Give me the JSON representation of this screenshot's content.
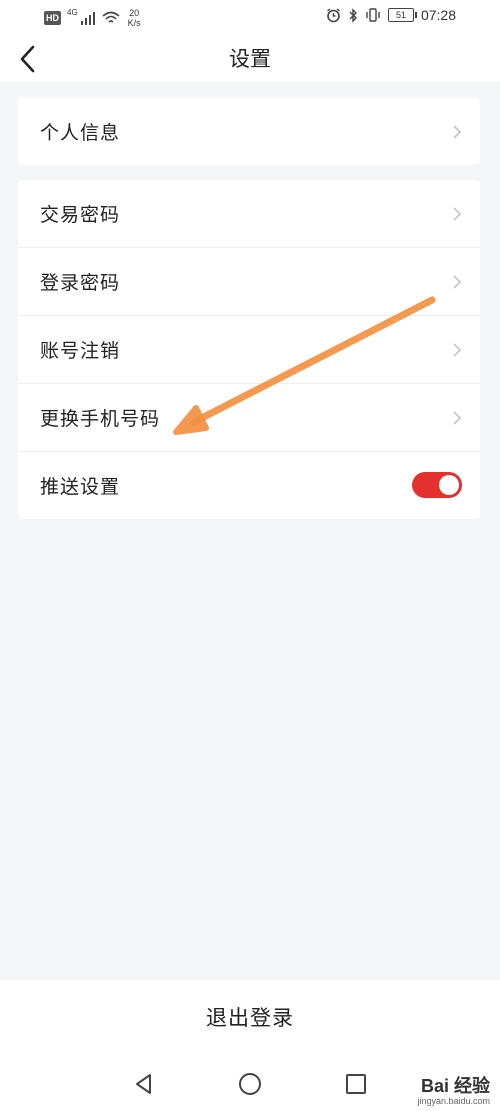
{
  "status_bar": {
    "hd": "HD",
    "network": "4G",
    "speed_value": "20",
    "speed_unit": "K/s",
    "battery": "51",
    "time": "07:28"
  },
  "header": {
    "title": "设置"
  },
  "groups": [
    {
      "items": [
        {
          "label": "个人信息"
        }
      ]
    },
    {
      "items": [
        {
          "label": "交易密码"
        },
        {
          "label": "登录密码"
        },
        {
          "label": "账号注销"
        },
        {
          "label": "更换手机号码"
        },
        {
          "label": "推送设置",
          "toggle_on": true
        }
      ]
    }
  ],
  "footer": {
    "logout_label": "退出登录"
  },
  "watermark": {
    "brand": "Bai 经验",
    "domain": "jingyan.baidu.com"
  },
  "colors": {
    "toggle_on": "#e3322d",
    "annotation_arrow": "#f39142",
    "background": "#f5f6f8"
  }
}
